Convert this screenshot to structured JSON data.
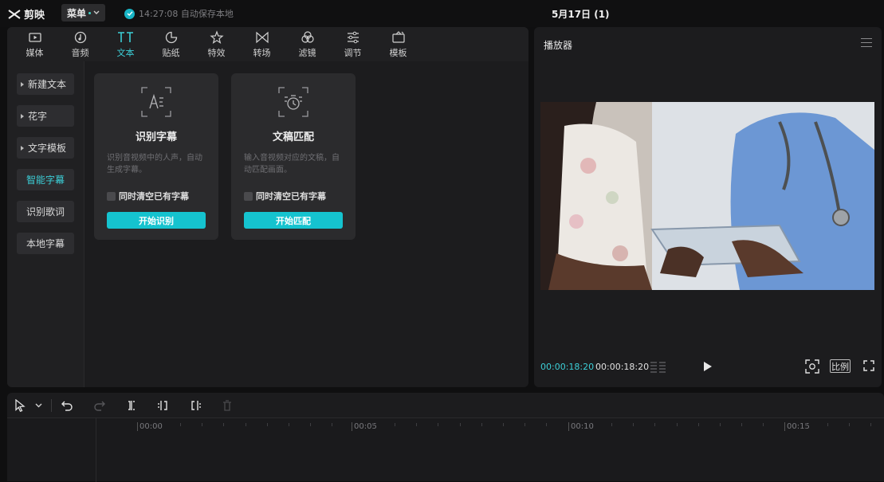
{
  "app": {
    "name": "剪映",
    "menu_label": "菜单",
    "save_status": "14:27:08 自动保存本地",
    "project_title": "5月17日 (1)"
  },
  "tabs": [
    {
      "label": "媒体",
      "icon": "media-icon"
    },
    {
      "label": "音频",
      "icon": "audio-icon"
    },
    {
      "label": "文本",
      "icon": "text-icon",
      "active": true
    },
    {
      "label": "贴纸",
      "icon": "sticker-icon"
    },
    {
      "label": "特效",
      "icon": "effects-icon"
    },
    {
      "label": "转场",
      "icon": "transition-icon"
    },
    {
      "label": "滤镜",
      "icon": "filter-icon"
    },
    {
      "label": "调节",
      "icon": "adjust-icon"
    },
    {
      "label": "模板",
      "icon": "template-icon"
    }
  ],
  "sidebar": {
    "items": [
      {
        "label": "新建文本",
        "expandable": true
      },
      {
        "label": "花字",
        "expandable": true
      },
      {
        "label": "文字模板",
        "expandable": true
      },
      {
        "label": "智能字幕",
        "active": true
      },
      {
        "label": "识别歌词"
      },
      {
        "label": "本地字幕"
      }
    ]
  },
  "cards": [
    {
      "title": "识别字幕",
      "description": "识别音视频中的人声，自动生成字幕。",
      "checkbox_label": "同时清空已有字幕",
      "checkbox_checked": false,
      "button_label": "开始识别",
      "icon": "speech-recognition-icon"
    },
    {
      "title": "文稿匹配",
      "description": "输入音视频对应的文稿，自动匹配画面。",
      "checkbox_label": "同时清空已有字幕",
      "checkbox_checked": false,
      "button_label": "开始匹配",
      "icon": "script-match-icon"
    }
  ],
  "player": {
    "title": "播放器",
    "current_time": "00:00:18:20",
    "total_time": "00:00:18:20",
    "ratio_label": "比例"
  },
  "timeline": {
    "ticks": [
      "00:00",
      "00:05",
      "00:10",
      "00:15"
    ]
  },
  "colors": {
    "accent": "#15c3cf",
    "accent_text": "#3ccfd8",
    "panel": "#1c1c1e",
    "background": "#0f0f10"
  }
}
